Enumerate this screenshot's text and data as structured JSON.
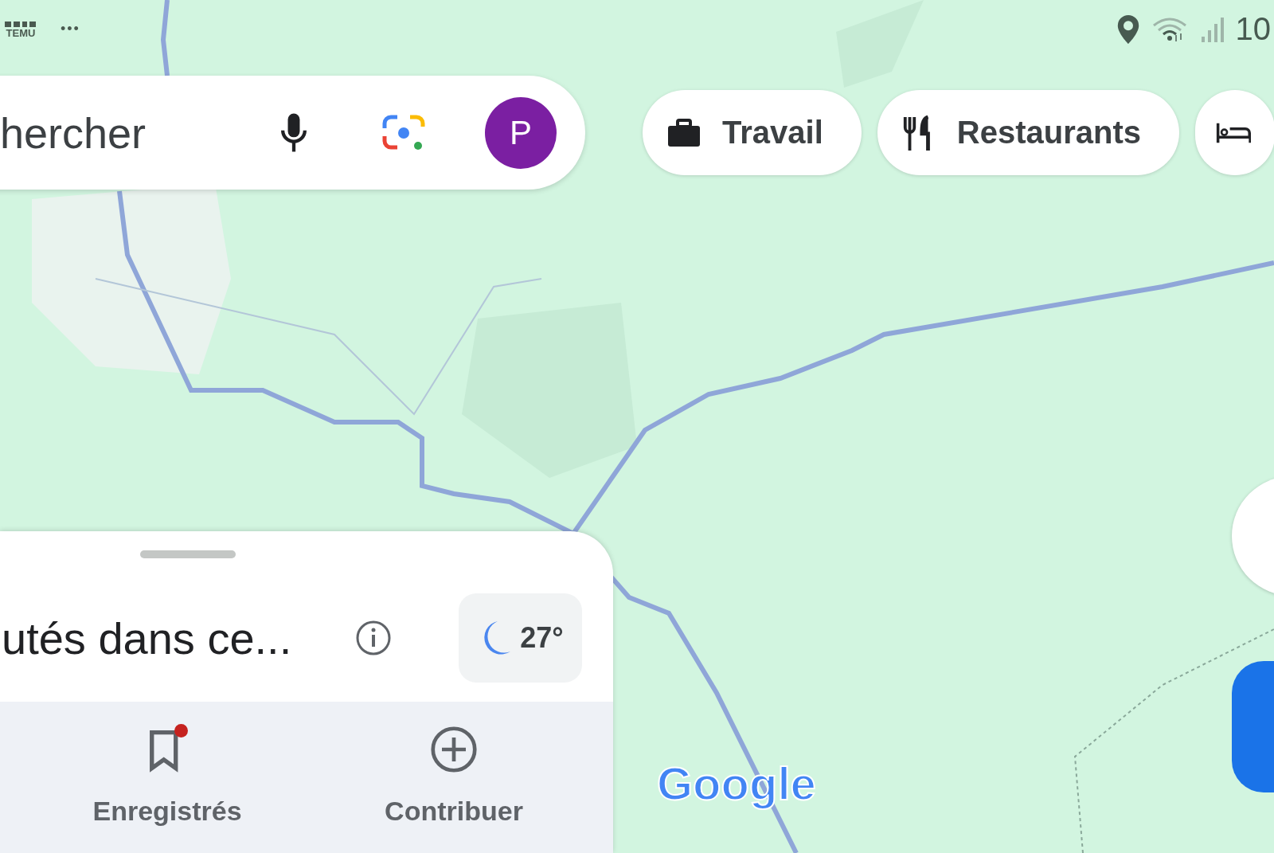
{
  "status_bar": {
    "notification_app": "TEMU",
    "more": "•••",
    "time": "10"
  },
  "search": {
    "placeholder": "hercher",
    "avatar": "P"
  },
  "chips": [
    {
      "label": "Travail",
      "kind": "briefcase"
    },
    {
      "label": "Restaurants",
      "kind": "restaurant"
    },
    {
      "kind": "hotel"
    }
  ],
  "sheet": {
    "title": "utés dans ce...",
    "weather": "27°"
  },
  "nav": [
    {
      "label": "Enregistrés",
      "kind": "saved",
      "badge": true
    },
    {
      "label": "Contribuer",
      "kind": "contribute",
      "badge": false
    }
  ],
  "attribution": "Google"
}
